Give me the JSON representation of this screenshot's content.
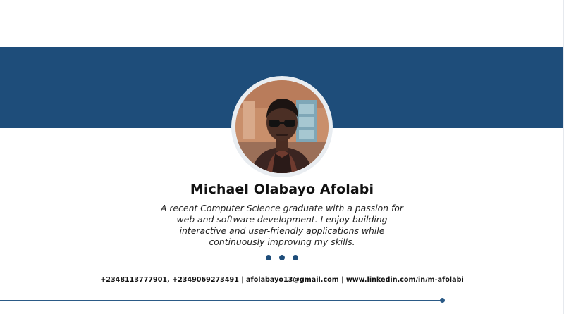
{
  "profile": {
    "name": "Michael Olabayo Afolabi",
    "bio": "A recent Computer Science graduate with a passion for web and software development. I enjoy building interactive and user-friendly applications while continuously improving my skills.",
    "contact": "+2348113777901, +2349069273491 | afolabayo13@gmail.com | www.linkedin.com/in/m-afolabi"
  },
  "theme": {
    "banner_color": "#1e4d7a",
    "accent_color": "#1e4d7a",
    "text_color": "#111111"
  },
  "icons": {
    "pager": "three-dots-icon",
    "footer": "line-end-dot-icon"
  }
}
